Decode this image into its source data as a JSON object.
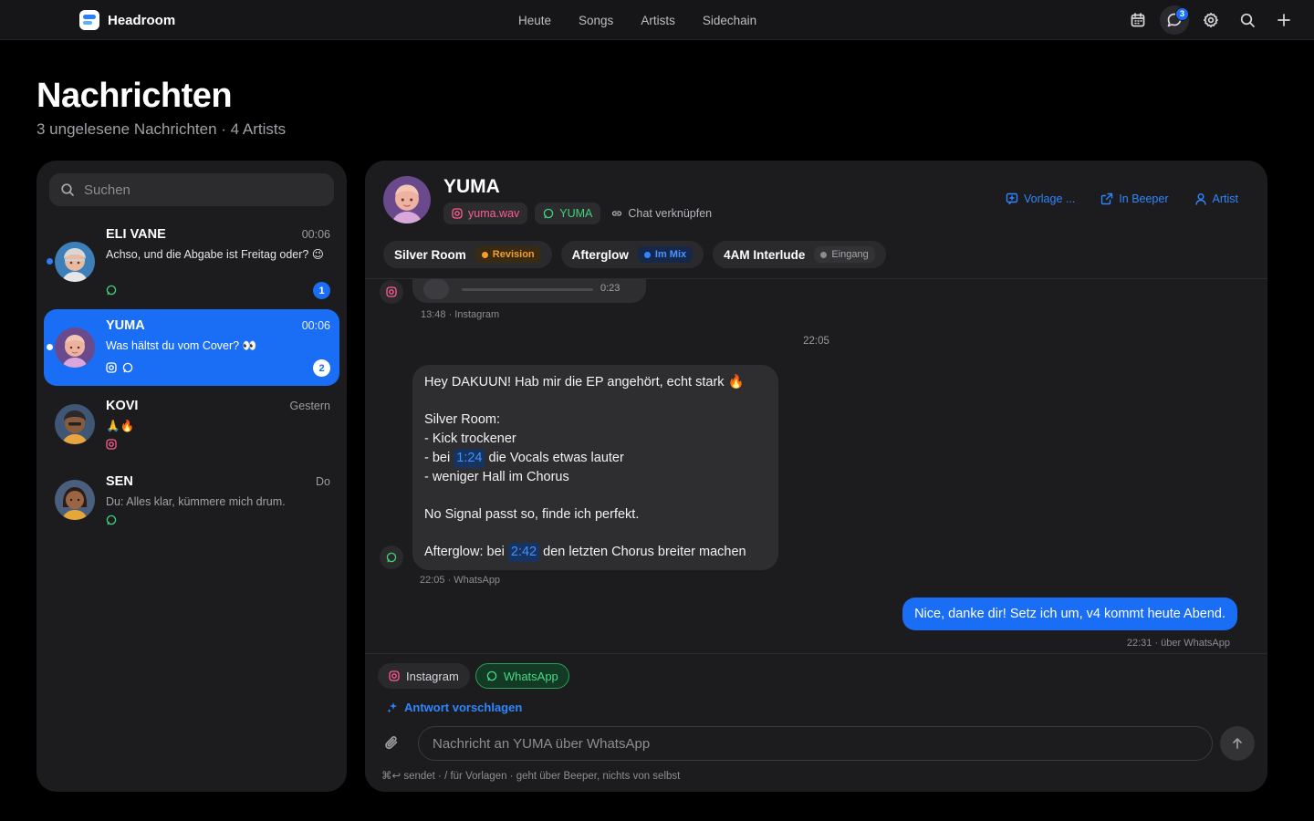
{
  "app": {
    "name": "Headroom"
  },
  "nav": [
    "Heute",
    "Songs",
    "Artists",
    "Sidechain"
  ],
  "topbar": {
    "message_badge": "3"
  },
  "page": {
    "title": "Nachrichten",
    "subtitle": "3 ungelesene Nachrichten · 4 Artists"
  },
  "search": {
    "placeholder": "Suchen"
  },
  "conversations": [
    {
      "name": "ELI VANE",
      "time": "00:06",
      "preview": "Achso, und die Abgabe ist Freitag oder? 😉",
      "unread": "1",
      "platforms": [
        "whatsapp"
      ]
    },
    {
      "name": "YUMA",
      "time": "00:06",
      "preview": "Was hältst du vom Cover? 👀",
      "unread": "2",
      "platforms": [
        "instagram",
        "whatsapp"
      ]
    },
    {
      "name": "KOVI",
      "time": "Gestern",
      "preview": "🙏🔥",
      "platforms": [
        "instagram"
      ]
    },
    {
      "name": "SEN",
      "time": "Do",
      "preview": "Du: Alles klar, kümmere mich drum.",
      "platforms": [
        "whatsapp"
      ]
    }
  ],
  "chat": {
    "name": "YUMA",
    "instagram_handle": "yuma.wav",
    "whatsapp_name": "YUMA",
    "link_label": "Chat verknüpfen",
    "actions": {
      "template": "Vorlage ...",
      "beeper": "In Beeper",
      "artist": "Artist"
    },
    "songs": [
      {
        "title": "Silver Room",
        "status": "Revision"
      },
      {
        "title": "Afterglow",
        "status": "Im Mix"
      },
      {
        "title": "4AM Interlude",
        "status": "Eingang"
      }
    ],
    "messages": {
      "voice_duration": "0:23",
      "voice_meta": "13:48 · Instagram",
      "day_separator": "22:05",
      "incoming": {
        "line1": "Hey DAKUUN! Hab mir die EP angehört, echt stark 🔥",
        "line2": "Silver Room:",
        "line3": "- Kick trockener",
        "line4_pre": "- bei ",
        "line4_ts": "1:24",
        "line4_post": " die Vocals etwas lauter",
        "line5": "- weniger Hall im Chorus",
        "line6": "No Signal passt so, finde ich perfekt.",
        "line7_pre": "Afterglow: bei ",
        "line7_ts": "2:42",
        "line7_post": " den letzten Chorus breiter machen"
      },
      "incoming_meta": "22:05 · WhatsApp",
      "outgoing": "Nice, danke dir! Setz ich um, v4 kommt heute Abend.",
      "outgoing_meta": "22:31 · über WhatsApp"
    },
    "composer": {
      "tab_instagram": "Instagram",
      "tab_whatsapp": "WhatsApp",
      "suggest": "Antwort vorschlagen",
      "placeholder": "Nachricht an YUMA über WhatsApp",
      "hint": "⌘↩ sendet · / für Vorlagen · geht über Beeper, nichts von selbst"
    }
  },
  "colors": {
    "accent": "#1a6ef5",
    "whatsapp": "#3fd27a",
    "instagram": "#ff5d8f",
    "revision": "#f0a030"
  }
}
